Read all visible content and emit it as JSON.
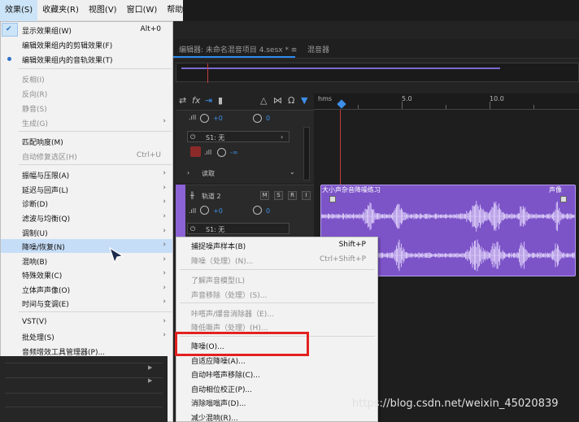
{
  "menubar": {
    "items": [
      "效果(S)",
      "收藏夹(R)",
      "视图(V)",
      "窗口(W)",
      "帮助(H)"
    ]
  },
  "editor": {
    "tab_editor": "编辑器: 未命名混音项目 4.sesx * ≡",
    "tab_mixer": "混音器",
    "ruler_unit": "hms",
    "ruler_labels": [
      "5.0",
      "10.0"
    ]
  },
  "track1": {
    "vol": "+0",
    "pan": "0",
    "send": "S1: 无",
    "pan_inf": "-∞",
    "read": "读取"
  },
  "track2": {
    "name": "轨道 2",
    "m": "M",
    "s": "S",
    "r": "R",
    "i": "I",
    "vol": "+0",
    "pan": "0",
    "send": "S1: 无"
  },
  "clip": {
    "title": "大小声杂音降噪练习",
    "tag": "声像"
  },
  "effects_menu": {
    "items": [
      {
        "label": "显示效果组(W)",
        "shortcut": "Alt+0",
        "state": "checked"
      },
      {
        "label": "编辑效果组内的剪辑效果(F)"
      },
      {
        "label": "编辑效果组内的音轨效果(T)",
        "state": "radio"
      },
      {
        "label": "反相(I)",
        "disabled": true
      },
      {
        "label": "反向(R)",
        "disabled": true
      },
      {
        "label": "静音(S)",
        "disabled": true
      },
      {
        "label": "生成(G)",
        "disabled": true,
        "submenu": true
      },
      {
        "label": "匹配响度(M)"
      },
      {
        "label": "自动修复选区(H)",
        "shortcut": "Ctrl+U",
        "disabled": true
      },
      {
        "label": "振幅与压限(A)",
        "submenu": true
      },
      {
        "label": "延迟与回声(L)",
        "submenu": true
      },
      {
        "label": "诊断(D)",
        "submenu": true
      },
      {
        "label": "滤波与均衡(Q)",
        "submenu": true
      },
      {
        "label": "调制(U)",
        "submenu": true
      },
      {
        "label": "降噪/恢复(N)",
        "submenu": true,
        "highlighted": true
      },
      {
        "label": "混响(B)",
        "submenu": true
      },
      {
        "label": "特殊效果(C)",
        "submenu": true
      },
      {
        "label": "立体声声像(O)",
        "submenu": true
      },
      {
        "label": "时间与变调(E)",
        "submenu": true
      },
      {
        "label": "VST(V)",
        "submenu": true
      },
      {
        "label": "批处理(S)",
        "submenu": true
      },
      {
        "label": "音频增效工具管理器(P)..."
      }
    ]
  },
  "noise_submenu": {
    "items": [
      {
        "label": "捕捉噪声样本(B)",
        "shortcut": "Shift+P"
      },
      {
        "label": "降噪（处理）(N)...",
        "shortcut": "Ctrl+Shift+P",
        "disabled": true
      },
      {
        "label": "了解声音模型(L)",
        "disabled": true
      },
      {
        "label": "声音移除（处理）(S)...",
        "disabled": true
      },
      {
        "label": "咔嗒声/爆音消除器（E)...",
        "disabled": true
      },
      {
        "label": "降低嘶声（处理）(H)...",
        "disabled": true
      },
      {
        "label": "降噪(O)..."
      },
      {
        "label": "自适应降噪(A)..."
      },
      {
        "label": "自动咔嗒声移除(C)..."
      },
      {
        "label": "自动相位校正(P)..."
      },
      {
        "label": "消除嗡嗡声(D)..."
      },
      {
        "label": "减少混响(R)..."
      }
    ]
  },
  "watermark": "https://blog.csdn.net/weixin_45020839",
  "colors": {
    "clip_fill": "#7c54c8",
    "highlight_box": "#e3211f",
    "menu_highlight": "#c6ddf7",
    "playhead": "#c43c3c"
  }
}
